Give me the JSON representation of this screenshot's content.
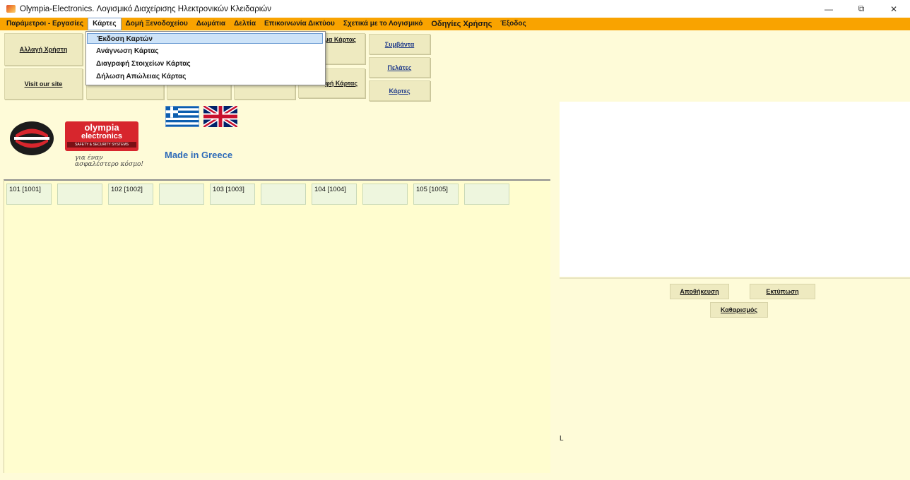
{
  "window": {
    "title": "Olympia-Electronics. Λογισμικό Διαχείρισης Ηλεκτρονικών Κλειδαριών",
    "minimize": "—",
    "restore": "⧉",
    "close": "✕"
  },
  "menubar": {
    "items": [
      "Παράμετροι - Εργασίες",
      "Κάρτες",
      "Δομή Ξενοδοχείου",
      "Δωμάτια",
      "Δελτία",
      "Επικοινωνία Δικτύου",
      "Σχετικά με το Λογισμικό",
      "Οδηγίες Χρήσης",
      "Έξοδος"
    ]
  },
  "dropdown": {
    "items": [
      "Έκδοση Καρτών",
      "Ανάγνωση Κάρτας",
      "Διαγραφή Στοιχείων Κάρτας",
      "Δήλωση Απώλειας Κάρτας"
    ]
  },
  "toolbar": {
    "change_user": "Αλλαγή Χρήστη",
    "visit_site": "Visit our site",
    "card_partial_top": "ομα Κάρτας",
    "card_partial_bottom": "φή Κάρτας",
    "events": "Συμβάντα",
    "customers": "Πελάτες",
    "cards": "Κάρτες"
  },
  "logo": {
    "brand_line1": "olympia",
    "brand_line2": "electronics",
    "brand_sub": "SAFETY & SECURITY SYSTEMS",
    "slogan_line1": "για έναν",
    "slogan_line2": "ασφαλέστερο κόσμο!",
    "made_in": "Made in Greece"
  },
  "rooms": [
    {
      "label": "101 [1001]"
    },
    {
      "label": ""
    },
    {
      "label": "102 [1002]"
    },
    {
      "label": ""
    },
    {
      "label": "103 [1003]"
    },
    {
      "label": ""
    },
    {
      "label": "104 [1004]"
    },
    {
      "label": ""
    },
    {
      "label": "105 [1005]"
    },
    {
      "label": ""
    }
  ],
  "actions": {
    "save": "Αποθήκευση",
    "print": "Εκτύπωση",
    "clear": "Καθαρισμός"
  },
  "status_label": "L",
  "colors": {
    "menubar": "#f9a300",
    "background": "#fefbd8",
    "room_tile": "#eef6de",
    "made_in": "#2d6ab8"
  }
}
